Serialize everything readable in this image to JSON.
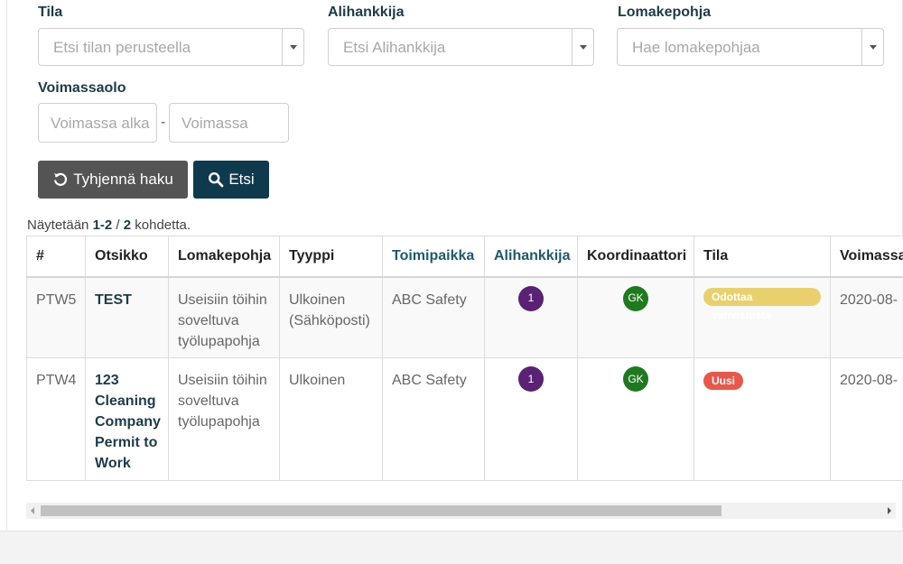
{
  "filters": {
    "tila": {
      "label": "Tila",
      "placeholder": "Etsi tilan perusteella"
    },
    "alihankkija": {
      "label": "Alihankkija",
      "placeholder": "Etsi Alihankkija"
    },
    "lomakepohja": {
      "label": "Lomakepohja",
      "placeholder": "Hae lomakepohjaa"
    },
    "voimassaolo": {
      "label": "Voimassaolo",
      "from_placeholder": "Voimassa alka",
      "to_placeholder": "Voimassa",
      "separator": "-"
    }
  },
  "buttons": {
    "clear": "Tyhjennä haku",
    "search": "Etsi"
  },
  "summary": {
    "prefix": "Näytetään",
    "range": "1-2",
    "sep": "/",
    "total": "2",
    "suffix": "kohdetta."
  },
  "table": {
    "columns": [
      "#",
      "Otsikko",
      "Lomakepohja",
      "Tyyppi",
      "Toimipaikka",
      "Alihankkija",
      "Koordinaattori",
      "Tila",
      "Voimassa"
    ],
    "rows": [
      {
        "id": "PTW5",
        "title": "TEST",
        "template": "Useisiin töihin soveltuva työlupapohja",
        "type": "Ulkoinen (Sähköposti)",
        "site": "ABC Safety",
        "subcontractor": "1",
        "coordinator": "GK",
        "status": "Odottaa vahvistusta",
        "valid": "2020-08-"
      },
      {
        "id": "PTW4",
        "title": "123 Cleaning Company Permit to Work",
        "template": "Useisiin töihin soveltuva työlupapohja",
        "type": "Ulkoinen",
        "site": "ABC Safety",
        "subcontractor": "1",
        "coordinator": "GK",
        "status": "Uusi",
        "valid": "2020-08-"
      }
    ]
  },
  "colors": {
    "primary": "#0f3a4d",
    "status_pending": "#ead06d",
    "status_new": "#e9574a",
    "subcontractor": "#5b2174",
    "coordinator": "#1f7a1f"
  },
  "icons": {
    "clear": "undo-icon",
    "search": "search-icon",
    "select": "chevron-down-icon"
  }
}
